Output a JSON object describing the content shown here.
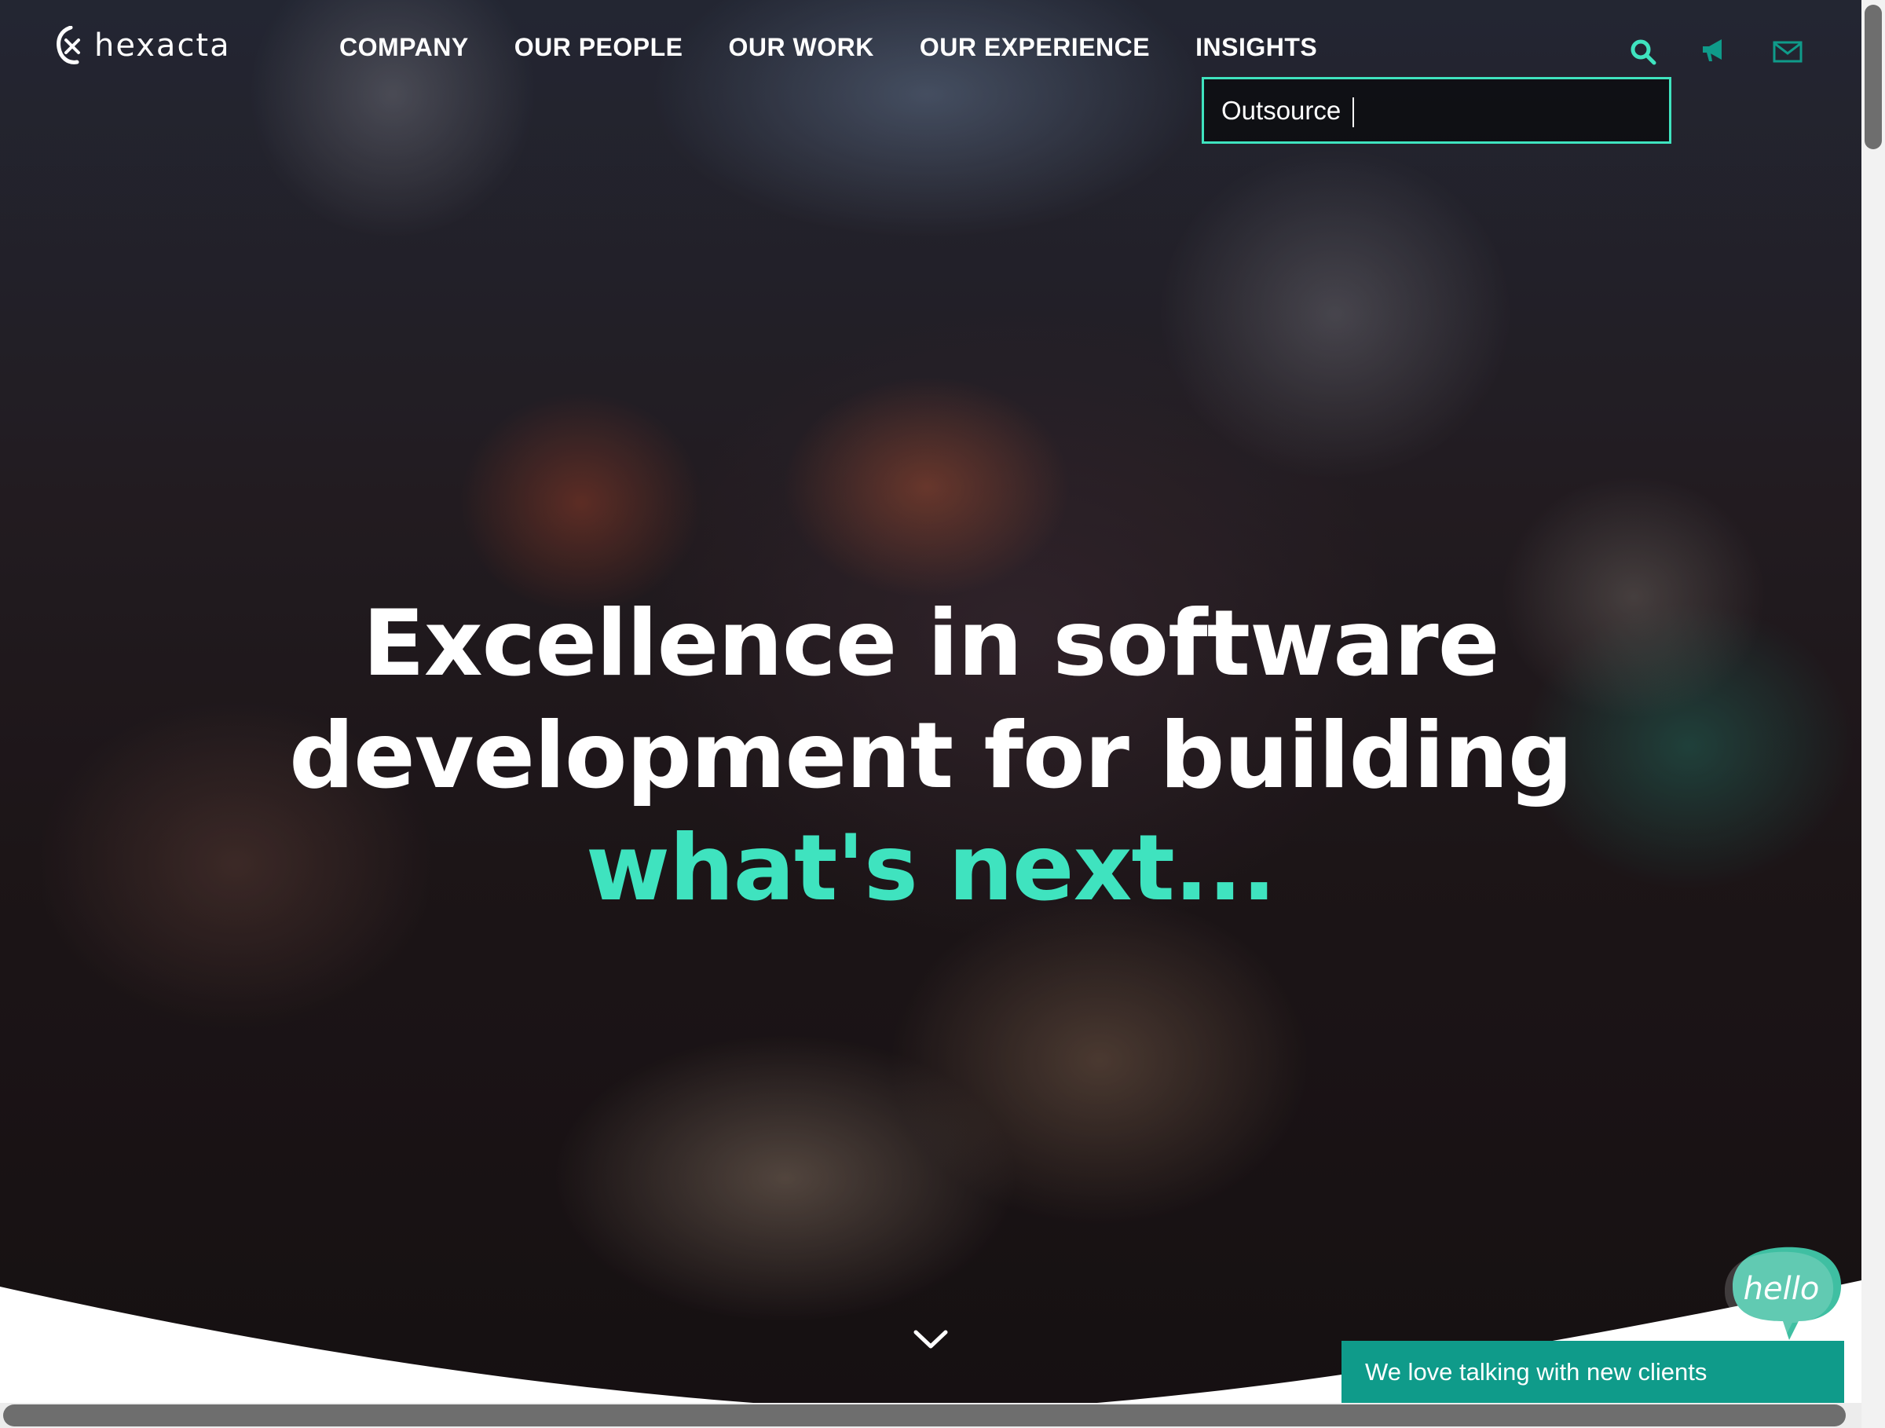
{
  "brand": {
    "logo_text": "hexacta"
  },
  "nav": {
    "items": [
      {
        "label": "COMPANY"
      },
      {
        "label": "OUR PEOPLE"
      },
      {
        "label": "OUR WORK"
      },
      {
        "label": "OUR EXPERIENCE"
      },
      {
        "label": "INSIGHTS"
      }
    ]
  },
  "header_icons": [
    "search-icon",
    "megaphone-icon",
    "envelope-icon"
  ],
  "search": {
    "value": "Outsource"
  },
  "hero": {
    "line1": "Excellence in software",
    "line2": "development for building",
    "line3": "what's next..."
  },
  "chat": {
    "bubble_text": "hello",
    "bar_text": "We love talking with new clients"
  },
  "colors": {
    "accent": "#3fe3bf",
    "chat_bar": "#0f9b8a",
    "text": "#ffffff"
  }
}
